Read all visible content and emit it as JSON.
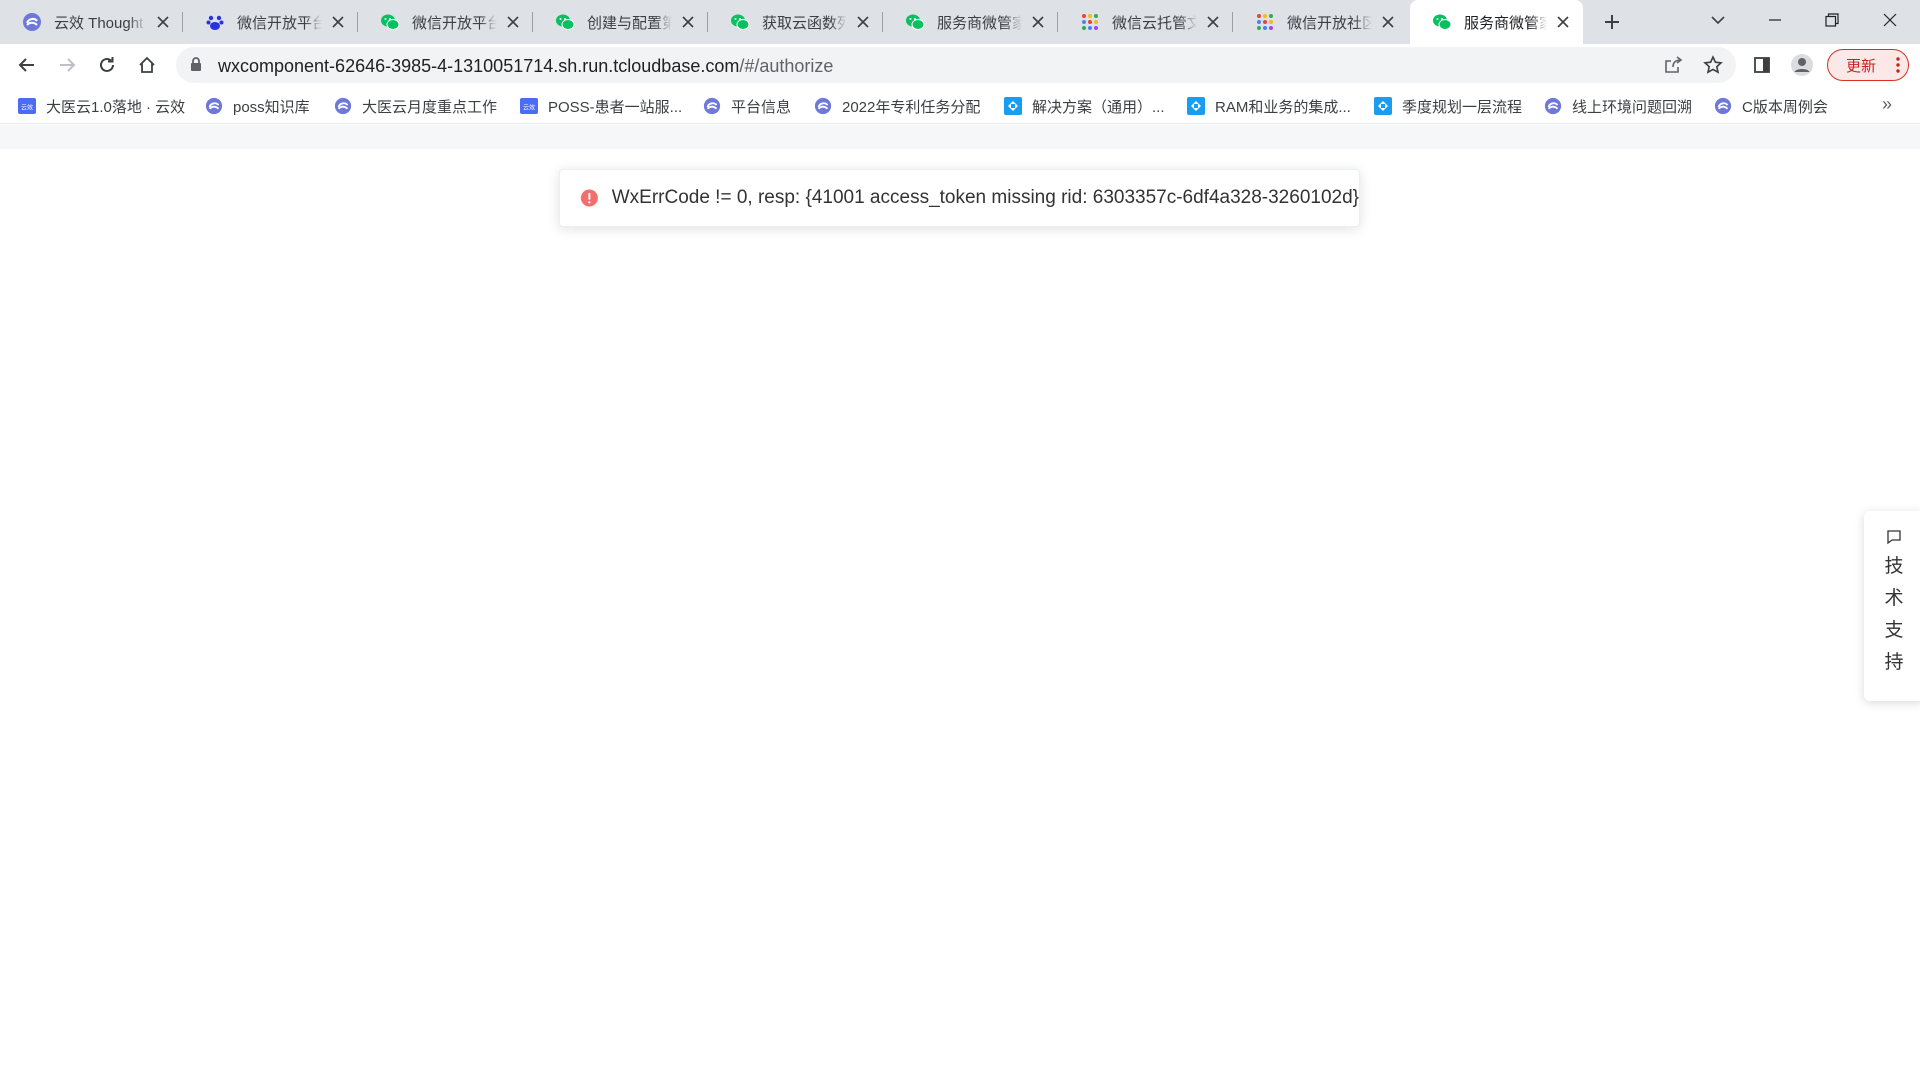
{
  "tabs": [
    {
      "title": "云效 Thought",
      "favicon": "yunxiao-icon"
    },
    {
      "title": "微信开放平台",
      "favicon": "baidu-paw-icon"
    },
    {
      "title": "微信开放平台",
      "favicon": "wechat-icon"
    },
    {
      "title": "创建与配置第",
      "favicon": "wechat-icon"
    },
    {
      "title": "获取云函数列",
      "favicon": "wechat-icon"
    },
    {
      "title": "服务商微管家",
      "favicon": "wechat-icon"
    },
    {
      "title": "微信云托管文",
      "favicon": "colorful-dots-icon"
    },
    {
      "title": "微信开放社区",
      "favicon": "colorful-dots-icon"
    },
    {
      "title": "服务商微管家",
      "favicon": "wechat-icon",
      "active": true
    }
  ],
  "address_bar": {
    "host": "wxcomponent-62646-3985-4-1310051714.sh.run.tcloudbase.com",
    "path": "/#/authorize"
  },
  "toolbar": {
    "update_label": "更新"
  },
  "bookmarks": [
    {
      "label": "大医云1.0落地 · 云效",
      "favicon": "yunxiao-square-icon"
    },
    {
      "label": "poss知识库",
      "favicon": "yunxiao-icon"
    },
    {
      "label": "大医云月度重点工作",
      "favicon": "yunxiao-icon"
    },
    {
      "label": "POSS-患者一站服...",
      "favicon": "yunxiao-square-icon"
    },
    {
      "label": "平台信息",
      "favicon": "yunxiao-icon"
    },
    {
      "label": "2022年专利任务分配",
      "favicon": "yunxiao-icon"
    },
    {
      "label": "解决方案（通用）...",
      "favicon": "dingtalk-doc-icon"
    },
    {
      "label": "RAM和业务的集成...",
      "favicon": "dingtalk-doc-icon"
    },
    {
      "label": "季度规划一层流程",
      "favicon": "dingtalk-doc-icon"
    },
    {
      "label": "线上环境问题回溯",
      "favicon": "yunxiao-icon"
    },
    {
      "label": "C版本周例会",
      "favicon": "yunxiao-icon"
    }
  ],
  "error_toast": {
    "message": "WxErrCode != 0, resp: {41001 access_token missing rid: 6303357c-6df4a328-3260102d}",
    "color": "#f56c6c"
  },
  "support_widget": {
    "chars": [
      "技",
      "术",
      "支",
      "持"
    ]
  },
  "colors": {
    "wechat_green": "#07c160",
    "yunxiao_purple": "#6e78d9",
    "dingtalk_blue": "#1a9cf0"
  }
}
